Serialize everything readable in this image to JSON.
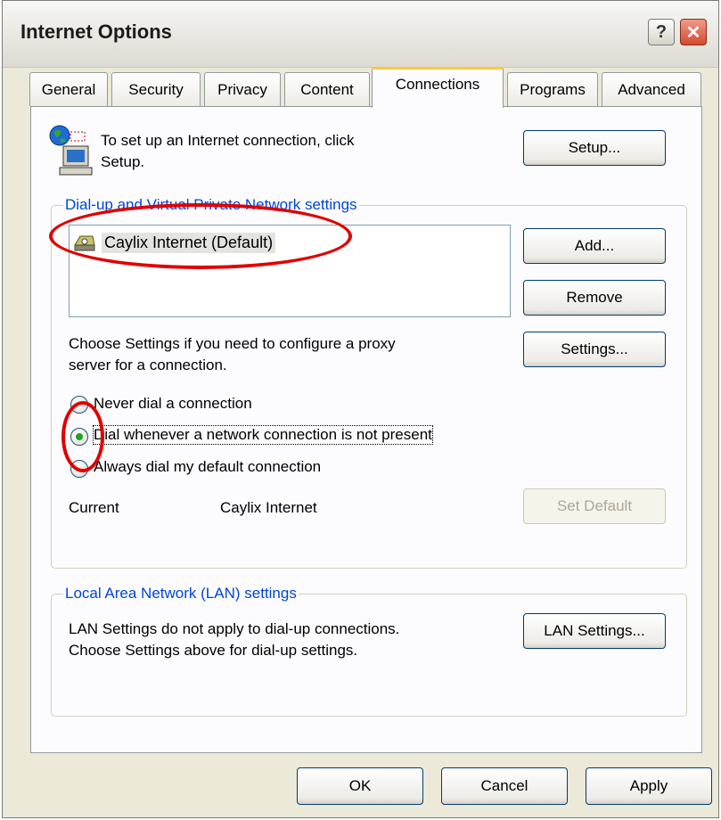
{
  "window": {
    "title": "Internet Options",
    "help_label": "?",
    "close_label": "✕"
  },
  "tabs": [
    {
      "label": "General"
    },
    {
      "label": "Security"
    },
    {
      "label": "Privacy"
    },
    {
      "label": "Content"
    },
    {
      "label": "Connections",
      "active": true
    },
    {
      "label": "Programs"
    },
    {
      "label": "Advanced"
    }
  ],
  "setup": {
    "line1": "To set up an Internet connection, click",
    "line2": "Setup.",
    "button": "Setup..."
  },
  "dialup": {
    "group_label": "Dial-up and Virtual Private Network settings",
    "connections": [
      "Caylix Internet (Default)"
    ],
    "add_button": "Add...",
    "remove_button": "Remove",
    "settings_line1": "Choose Settings if you need to configure a proxy",
    "settings_line2": "server for a connection.",
    "settings_button": "Settings...",
    "radio_never": "Never dial a connection",
    "radio_whenever": "Dial whenever a network connection is not present",
    "radio_always": "Always dial my default connection",
    "selected_radio": "radio_whenever",
    "current_label": "Current",
    "current_value": "Caylix Internet",
    "set_default_button": "Set Default"
  },
  "lan": {
    "group_label": "Local Area Network (LAN) settings",
    "line1": "LAN Settings do not apply to dial-up connections.",
    "line2": "Choose Settings above for dial-up settings.",
    "button": "LAN Settings..."
  },
  "footer": {
    "ok": "OK",
    "cancel": "Cancel",
    "apply": "Apply"
  },
  "colors": {
    "accent": "#0046d5",
    "highlight_ring": "#e00000",
    "active_tab_top": "#ffc83c"
  }
}
